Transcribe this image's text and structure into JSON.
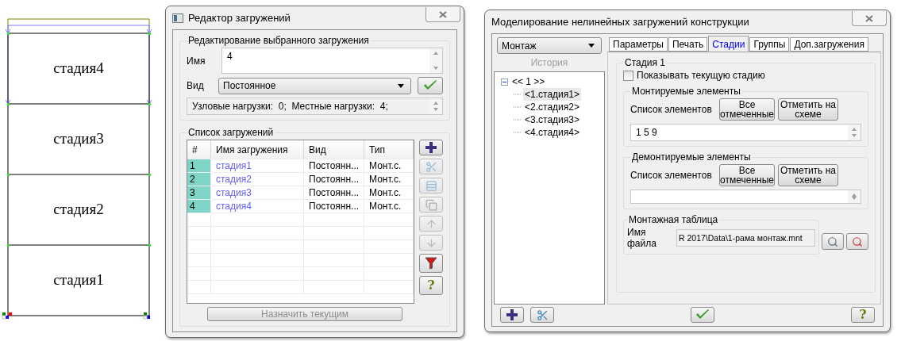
{
  "frame": {
    "stages": [
      "стадия4",
      "стадия3",
      "стадия2",
      "стадия1"
    ]
  },
  "load_editor": {
    "title": "Редактор загружений",
    "edit_group": {
      "title": "Редактирование выбранного загружения",
      "name_label": "Имя",
      "name_value": "4",
      "kind_label": "Вид",
      "kind_value": "Постоянное",
      "info": "Узловые нагрузки:  0;  Местные нагрузки:  4;"
    },
    "list_group": {
      "title": "Список загружений",
      "columns": [
        "#",
        "Имя загружения",
        "Вид",
        "Тип"
      ],
      "rows": [
        {
          "num": "1",
          "name": "стадия1",
          "kind": "Постоянн...",
          "type": "Монт.с."
        },
        {
          "num": "2",
          "name": "стадия2",
          "kind": "Постоянн...",
          "type": "Монт.с."
        },
        {
          "num": "3",
          "name": "стадия3",
          "kind": "Постоянн...",
          "type": "Монт.с."
        },
        {
          "num": "4",
          "name": "стадия4",
          "kind": "Постоянн...",
          "type": "Монт.с."
        }
      ]
    },
    "side_buttons": [
      {
        "kind": "add",
        "disabled": false
      },
      {
        "kind": "cut",
        "disabled": true
      },
      {
        "kind": "insert",
        "disabled": true
      },
      {
        "kind": "copy",
        "disabled": true
      },
      {
        "kind": "up",
        "disabled": true
      },
      {
        "kind": "down",
        "disabled": true
      },
      {
        "kind": "filter",
        "disabled": false
      },
      {
        "kind": "help",
        "label": "?",
        "disabled": false
      }
    ],
    "assign_button": {
      "label": "Назначить текущим",
      "disabled": true
    }
  },
  "modeling": {
    "title": "Моделирование нелинейных загружений конструкции",
    "mode": "Монтаж",
    "history": {
      "label": "История",
      "disabled": true
    },
    "tree": {
      "label": "<< 1 >>",
      "expanded": true,
      "children": [
        {
          "label": "<1.стадия1>",
          "selected": true
        },
        {
          "label": "<2.стадия2>",
          "selected": false
        },
        {
          "label": "<3.стадия3>",
          "selected": false
        },
        {
          "label": "<4.стадия4>",
          "selected": false
        }
      ]
    },
    "tabs": [
      {
        "label": "Параметры",
        "selected": false
      },
      {
        "label": "Печать",
        "selected": false
      },
      {
        "label": "Стадии",
        "selected": true
      },
      {
        "label": "Группы",
        "selected": false
      },
      {
        "label": "Доп.загружения",
        "selected": false
      }
    ],
    "stage": {
      "title": "Стадия 1",
      "show_current": {
        "label": "Показывать текущую стадию",
        "checked": false
      },
      "mounted": {
        "title": "Монтируемые элементы",
        "list_label": "Список элементов",
        "buttons": [
          "Все отмеченные",
          "Отметить на схеме"
        ],
        "value": "1 5 9"
      },
      "dismounted": {
        "title": "Демонтируемые элементы",
        "list_label": "Список элементов",
        "buttons": [
          "Все отмеченные",
          "Отметить на схеме"
        ]
      },
      "table": {
        "title": "Монтажная таблица",
        "file_label": "Имя файла",
        "file_value": "R 2017\\Data\\1-рама монтаж.mnt"
      }
    },
    "bottom_buttons": [
      {
        "kind": "add",
        "disabled": false
      },
      {
        "kind": "cut",
        "disabled": false
      },
      {
        "kind": "ok",
        "disabled": false
      },
      {
        "kind": "help",
        "label": "?",
        "disabled": false
      }
    ]
  }
}
